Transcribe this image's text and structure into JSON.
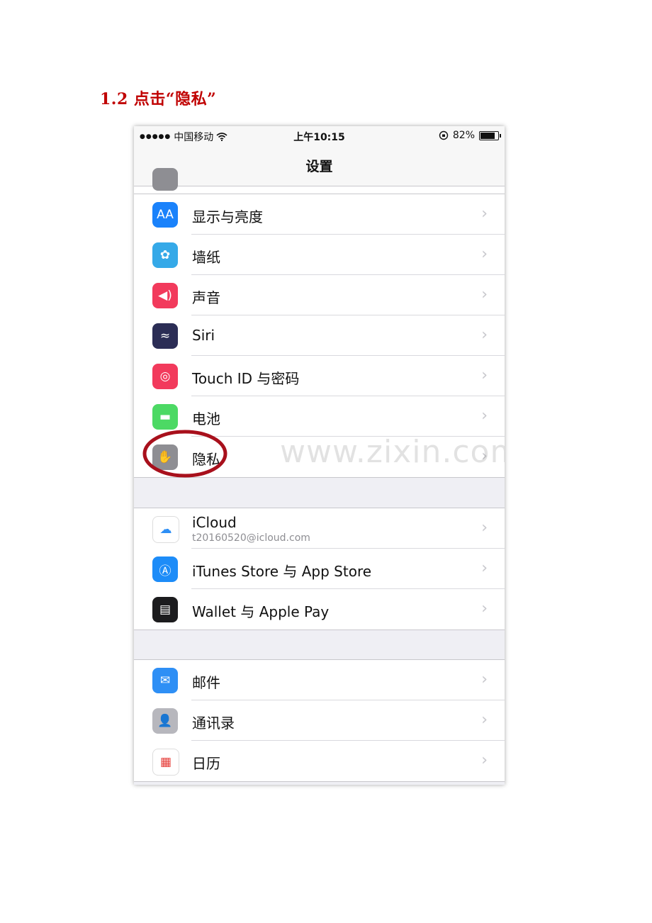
{
  "document": {
    "heading": "1.2  点击“隐私”"
  },
  "statusbar": {
    "carrier_dots": "●●●●●",
    "carrier": "中国移动",
    "time": "上午10:15",
    "battery_percent": "82%",
    "battery_level": 0.82
  },
  "navbar": {
    "title": "设置"
  },
  "groups": [
    {
      "items": [
        {
          "label": "显示与亮度",
          "icon": "display-brightness-icon",
          "color": "#1a82fb",
          "glyph": "AA"
        },
        {
          "label": "墙纸",
          "icon": "wallpaper-flower-icon",
          "color": "#35a9e8",
          "glyph": "✿"
        },
        {
          "label": "声音",
          "icon": "sound-speaker-icon",
          "color": "#f23a5c",
          "glyph": "◀)"
        },
        {
          "label": "Siri",
          "icon": "siri-icon",
          "color": "#2b2d55",
          "glyph": "≈"
        },
        {
          "label": "Touch ID 与密码",
          "icon": "fingerprint-icon",
          "color": "#f23a5c",
          "glyph": "◎"
        },
        {
          "label": "电池",
          "icon": "battery-icon",
          "color": "#4cd964",
          "glyph": "▬"
        },
        {
          "label": "隐私",
          "icon": "privacy-hand-icon",
          "color": "#8e8e93",
          "glyph": "✋"
        }
      ]
    },
    {
      "items": [
        {
          "label": "iCloud",
          "sublabel": "t20160520@icloud.com",
          "icon": "icloud-icon",
          "color": "#ffffff",
          "glyph": "☁"
        },
        {
          "label": "iTunes Store 与 App Store",
          "icon": "app-store-icon",
          "color": "#1d8cf8",
          "glyph": "Ⓐ"
        },
        {
          "label": "Wallet 与 Apple Pay",
          "icon": "wallet-icon",
          "color": "#1c1c1e",
          "glyph": "▤"
        }
      ]
    },
    {
      "items": [
        {
          "label": "邮件",
          "icon": "mail-icon",
          "color": "#2e8ff5",
          "glyph": "✉"
        },
        {
          "label": "通讯录",
          "icon": "contacts-icon",
          "color": "#b7b7bd",
          "glyph": "👤"
        },
        {
          "label": "日历",
          "icon": "calendar-icon",
          "color": "#ffffff",
          "glyph": "▦"
        }
      ]
    }
  ],
  "watermark": "www.zixin.com.cn",
  "chevron": "›"
}
